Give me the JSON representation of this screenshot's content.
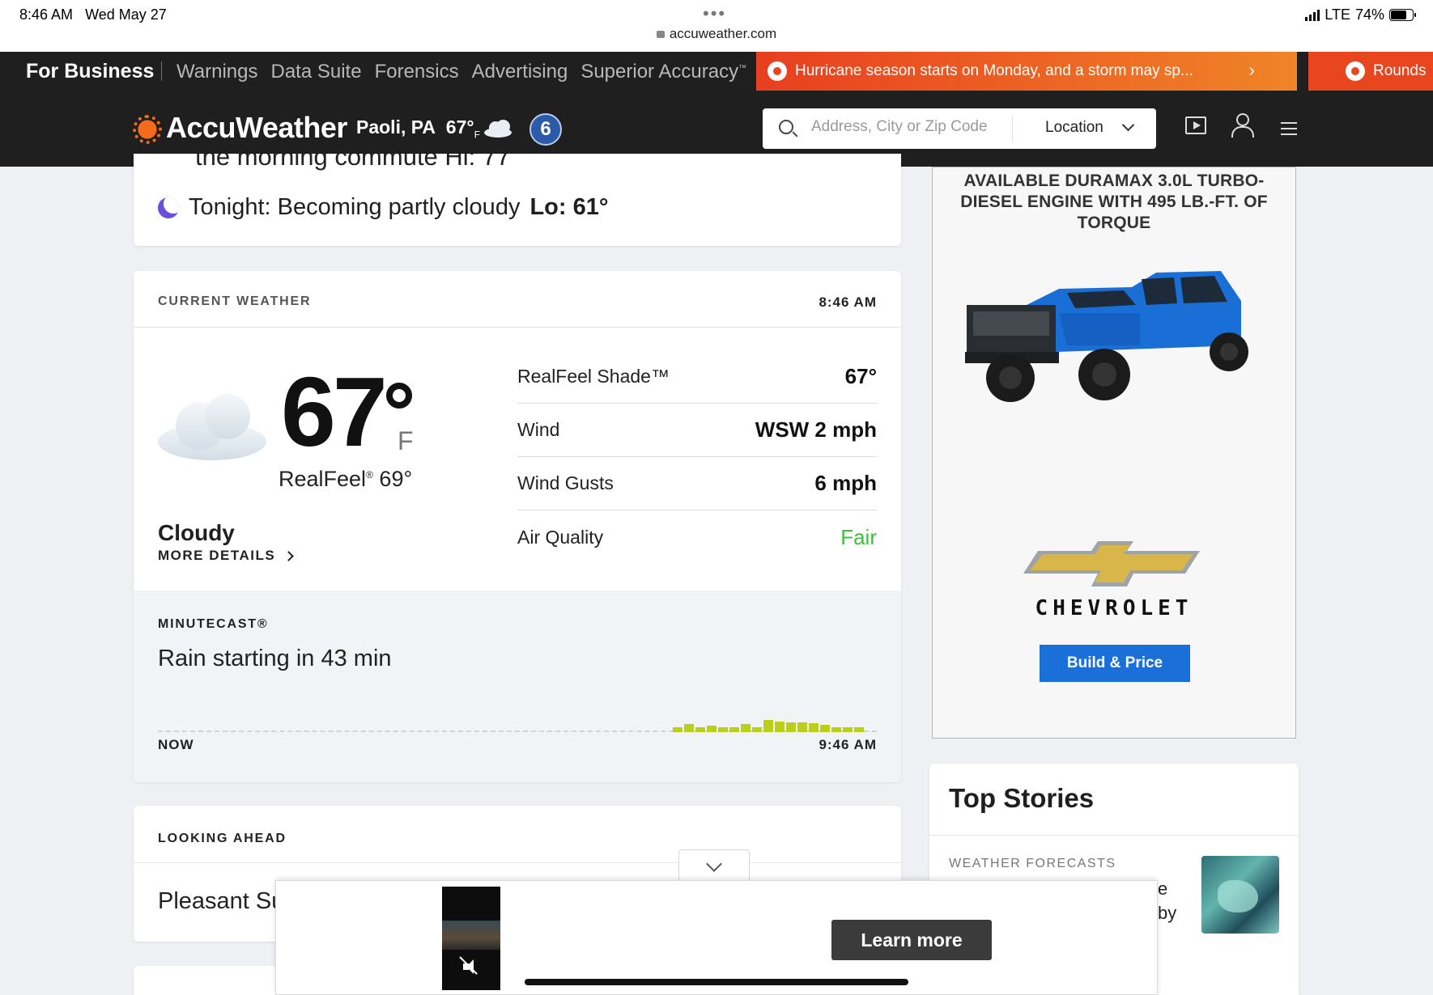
{
  "status_bar": {
    "time": "8:46 AM",
    "date": "Wed May 27",
    "url": "accuweather.com",
    "carrier": "LTE",
    "battery": "74%"
  },
  "business_bar": {
    "title": "For Business",
    "links": [
      "Warnings",
      "Data Suite",
      "Forensics",
      "Advertising",
      "Superior Accuracy"
    ],
    "alert_text": "Hurricane season starts on Monday, and a storm may sp...",
    "alert2_text": "Rounds"
  },
  "header": {
    "logo": "AccuWeather",
    "location": "Paoli, PA",
    "temp": "67°",
    "temp_unit": "F",
    "badge": "6",
    "search_placeholder": "Address, City or Zip Code",
    "location_select": "Location"
  },
  "tonight": {
    "cut_text": "the morning commute Hi: 77",
    "label": "Tonight: Becoming partly cloudy",
    "lo_label": "Lo: 61°"
  },
  "current_weather": {
    "title": "CURRENT WEATHER",
    "time": "8:46 AM",
    "temp": "67",
    "unit": "F",
    "realfeel_label": "RealFeel",
    "realfeel_value": "69°",
    "condition": "Cloudy",
    "more_details": "MORE DETAILS",
    "details": [
      {
        "label": "RealFeel Shade™",
        "value": "67°"
      },
      {
        "label": "Wind",
        "value": "WSW 2 mph"
      },
      {
        "label": "Wind Gusts",
        "value": "6 mph"
      },
      {
        "label": "Air Quality",
        "value": "Fair"
      }
    ]
  },
  "minutecast": {
    "title": "MINUTECAST®",
    "text": "Rain starting in 43 min",
    "start_label": "NOW",
    "end_label": "9:46 AM",
    "bar_levels": [
      0.3,
      0.45,
      0.3,
      0.35,
      0.3,
      0.3,
      0.45,
      0.3,
      0.7,
      0.6,
      0.55,
      0.55,
      0.5,
      0.4,
      0.3,
      0.3,
      0.3
    ]
  },
  "looking_ahead": {
    "title": "LOOKING AHEAD",
    "text": "Pleasant Su"
  },
  "ad": {
    "headline": "AVAILABLE DURAMAX 3.0L TURBO-DIESEL ENGINE WITH 495 LB.-FT. OF TORQUE",
    "brand": "CHEVROLET",
    "cta": "Build & Price",
    "truck_color": "#1a6fd6"
  },
  "top_stories": {
    "title": "Top Stories",
    "category": "WEATHER FORECASTS",
    "snippet_lines": [
      "e",
      "by"
    ]
  },
  "video_ad": {
    "cta": "Learn more"
  },
  "colors": {
    "alert_start": "#e83f1f",
    "alert_end": "#f08428",
    "air_quality_fair": "#3cc13a",
    "minutecast_bar": "#b9cf1a",
    "build_button": "#1b6fd8"
  }
}
